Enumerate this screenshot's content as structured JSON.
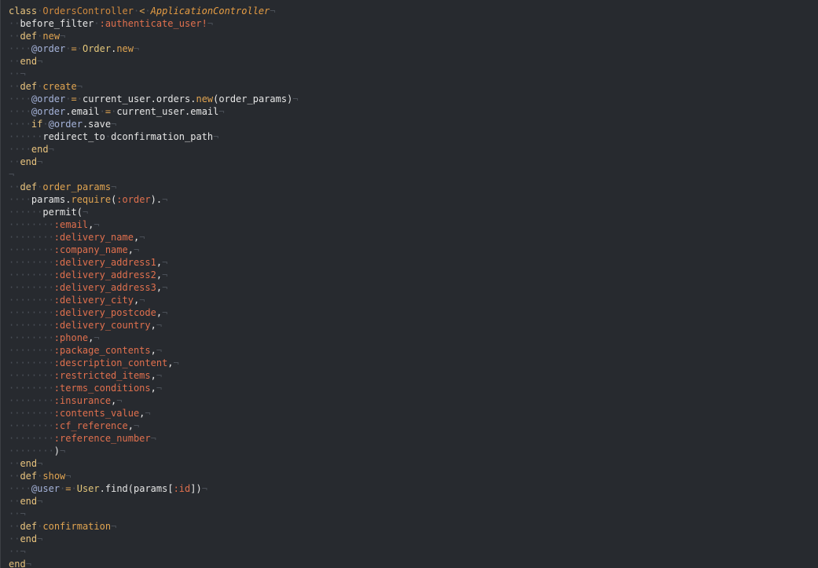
{
  "editor": {
    "lines": [
      [
        {
          "t": "class",
          "c": "kw"
        },
        {
          "t": "·",
          "c": "ws"
        },
        {
          "t": "OrdersController",
          "c": "cls"
        },
        {
          "t": "·",
          "c": "ws"
        },
        {
          "t": "<",
          "c": "op"
        },
        {
          "t": "·",
          "c": "ws"
        },
        {
          "t": "ApplicationController",
          "c": "inh"
        },
        {
          "t": "¬",
          "c": "nl"
        }
      ],
      [
        {
          "t": "··",
          "c": "ws"
        },
        {
          "t": "before_filter",
          "c": "plain"
        },
        {
          "t": "·",
          "c": "ws"
        },
        {
          "t": ":authenticate_user!",
          "c": "sym"
        },
        {
          "t": "¬",
          "c": "nl"
        }
      ],
      [
        {
          "t": "··",
          "c": "ws"
        },
        {
          "t": "def",
          "c": "kw"
        },
        {
          "t": "·",
          "c": "ws"
        },
        {
          "t": "new",
          "c": "meth"
        },
        {
          "t": "¬",
          "c": "nl"
        }
      ],
      [
        {
          "t": "····",
          "c": "ws"
        },
        {
          "t": "@order",
          "c": "ivar"
        },
        {
          "t": "·",
          "c": "ws"
        },
        {
          "t": "=",
          "c": "op"
        },
        {
          "t": "·",
          "c": "ws"
        },
        {
          "t": "Order",
          "c": "const"
        },
        {
          "t": ".",
          "c": "plain"
        },
        {
          "t": "new",
          "c": "meth"
        },
        {
          "t": "¬",
          "c": "nl"
        }
      ],
      [
        {
          "t": "··",
          "c": "ws"
        },
        {
          "t": "end",
          "c": "kw"
        },
        {
          "t": "¬",
          "c": "nl"
        }
      ],
      [
        {
          "t": "··",
          "c": "ws"
        },
        {
          "t": "¬",
          "c": "nl"
        }
      ],
      [
        {
          "t": "··",
          "c": "ws"
        },
        {
          "t": "def",
          "c": "kw"
        },
        {
          "t": "·",
          "c": "ws"
        },
        {
          "t": "create",
          "c": "meth"
        },
        {
          "t": "¬",
          "c": "nl"
        }
      ],
      [
        {
          "t": "····",
          "c": "ws"
        },
        {
          "t": "@order",
          "c": "ivar"
        },
        {
          "t": "·",
          "c": "ws"
        },
        {
          "t": "=",
          "c": "op"
        },
        {
          "t": "·",
          "c": "ws"
        },
        {
          "t": "current_user.orders.",
          "c": "plain"
        },
        {
          "t": "new",
          "c": "meth"
        },
        {
          "t": "(order_params)",
          "c": "plain"
        },
        {
          "t": "¬",
          "c": "nl"
        }
      ],
      [
        {
          "t": "····",
          "c": "ws"
        },
        {
          "t": "@order",
          "c": "ivar"
        },
        {
          "t": ".email",
          "c": "plain"
        },
        {
          "t": "·",
          "c": "ws"
        },
        {
          "t": "=",
          "c": "op"
        },
        {
          "t": "·",
          "c": "ws"
        },
        {
          "t": "current_user.email",
          "c": "plain"
        },
        {
          "t": "¬",
          "c": "nl"
        }
      ],
      [
        {
          "t": "····",
          "c": "ws"
        },
        {
          "t": "if",
          "c": "kw"
        },
        {
          "t": "·",
          "c": "ws"
        },
        {
          "t": "@order",
          "c": "ivar"
        },
        {
          "t": ".save",
          "c": "plain"
        },
        {
          "t": "¬",
          "c": "nl"
        }
      ],
      [
        {
          "t": "······",
          "c": "ws"
        },
        {
          "t": "redirect_to",
          "c": "plain"
        },
        {
          "t": "·",
          "c": "ws"
        },
        {
          "t": "dconfirmation_path",
          "c": "plain"
        },
        {
          "t": "¬",
          "c": "nl"
        }
      ],
      [
        {
          "t": "····",
          "c": "ws"
        },
        {
          "t": "end",
          "c": "kw"
        },
        {
          "t": "¬",
          "c": "nl"
        }
      ],
      [
        {
          "t": "··",
          "c": "ws"
        },
        {
          "t": "end",
          "c": "kw"
        },
        {
          "t": "¬",
          "c": "nl"
        }
      ],
      [
        {
          "t": "¬",
          "c": "nl"
        }
      ],
      [
        {
          "t": "··",
          "c": "ws"
        },
        {
          "t": "def",
          "c": "kw"
        },
        {
          "t": "·",
          "c": "ws"
        },
        {
          "t": "order_params",
          "c": "meth"
        },
        {
          "t": "¬",
          "c": "nl"
        }
      ],
      [
        {
          "t": "····",
          "c": "ws"
        },
        {
          "t": "params.",
          "c": "plain"
        },
        {
          "t": "require",
          "c": "meth"
        },
        {
          "t": "(",
          "c": "plain"
        },
        {
          "t": ":order",
          "c": "sym"
        },
        {
          "t": ").",
          "c": "plain"
        },
        {
          "t": "¬",
          "c": "nl"
        }
      ],
      [
        {
          "t": "······",
          "c": "ws"
        },
        {
          "t": "permit(",
          "c": "plain"
        },
        {
          "t": "¬",
          "c": "nl"
        }
      ],
      [
        {
          "t": "········",
          "c": "ws"
        },
        {
          "t": ":email",
          "c": "sym"
        },
        {
          "t": ",",
          "c": "plain"
        },
        {
          "t": "¬",
          "c": "nl"
        }
      ],
      [
        {
          "t": "········",
          "c": "ws"
        },
        {
          "t": ":delivery_name",
          "c": "sym"
        },
        {
          "t": ",",
          "c": "plain"
        },
        {
          "t": "¬",
          "c": "nl"
        }
      ],
      [
        {
          "t": "········",
          "c": "ws"
        },
        {
          "t": ":company_name",
          "c": "sym"
        },
        {
          "t": ",",
          "c": "plain"
        },
        {
          "t": "¬",
          "c": "nl"
        }
      ],
      [
        {
          "t": "········",
          "c": "ws"
        },
        {
          "t": ":delivery_address1",
          "c": "sym"
        },
        {
          "t": ",",
          "c": "plain"
        },
        {
          "t": "¬",
          "c": "nl"
        }
      ],
      [
        {
          "t": "········",
          "c": "ws"
        },
        {
          "t": ":delivery_address2",
          "c": "sym"
        },
        {
          "t": ",",
          "c": "plain"
        },
        {
          "t": "¬",
          "c": "nl"
        }
      ],
      [
        {
          "t": "········",
          "c": "ws"
        },
        {
          "t": ":delivery_address3",
          "c": "sym"
        },
        {
          "t": ",",
          "c": "plain"
        },
        {
          "t": "¬",
          "c": "nl"
        }
      ],
      [
        {
          "t": "········",
          "c": "ws"
        },
        {
          "t": ":delivery_city",
          "c": "sym"
        },
        {
          "t": ",",
          "c": "plain"
        },
        {
          "t": "¬",
          "c": "nl"
        }
      ],
      [
        {
          "t": "········",
          "c": "ws"
        },
        {
          "t": ":delivery_postcode",
          "c": "sym"
        },
        {
          "t": ",",
          "c": "plain"
        },
        {
          "t": "¬",
          "c": "nl"
        }
      ],
      [
        {
          "t": "········",
          "c": "ws"
        },
        {
          "t": ":delivery_country",
          "c": "sym"
        },
        {
          "t": ",",
          "c": "plain"
        },
        {
          "t": "¬",
          "c": "nl"
        }
      ],
      [
        {
          "t": "········",
          "c": "ws"
        },
        {
          "t": ":phone",
          "c": "sym"
        },
        {
          "t": ",",
          "c": "plain"
        },
        {
          "t": "¬",
          "c": "nl"
        }
      ],
      [
        {
          "t": "········",
          "c": "ws"
        },
        {
          "t": ":package_contents",
          "c": "sym"
        },
        {
          "t": ",",
          "c": "plain"
        },
        {
          "t": "¬",
          "c": "nl"
        }
      ],
      [
        {
          "t": "········",
          "c": "ws"
        },
        {
          "t": ":description_content",
          "c": "sym"
        },
        {
          "t": ",",
          "c": "plain"
        },
        {
          "t": "¬",
          "c": "nl"
        }
      ],
      [
        {
          "t": "········",
          "c": "ws"
        },
        {
          "t": ":restricted_items",
          "c": "sym"
        },
        {
          "t": ",",
          "c": "plain"
        },
        {
          "t": "¬",
          "c": "nl"
        }
      ],
      [
        {
          "t": "········",
          "c": "ws"
        },
        {
          "t": ":terms_conditions",
          "c": "sym"
        },
        {
          "t": ",",
          "c": "plain"
        },
        {
          "t": "¬",
          "c": "nl"
        }
      ],
      [
        {
          "t": "········",
          "c": "ws"
        },
        {
          "t": ":insurance",
          "c": "sym"
        },
        {
          "t": ",",
          "c": "plain"
        },
        {
          "t": "¬",
          "c": "nl"
        }
      ],
      [
        {
          "t": "········",
          "c": "ws"
        },
        {
          "t": ":contents_value",
          "c": "sym"
        },
        {
          "t": ",",
          "c": "plain"
        },
        {
          "t": "¬",
          "c": "nl"
        }
      ],
      [
        {
          "t": "········",
          "c": "ws"
        },
        {
          "t": ":cf_reference",
          "c": "sym"
        },
        {
          "t": ",",
          "c": "plain"
        },
        {
          "t": "¬",
          "c": "nl"
        }
      ],
      [
        {
          "t": "········",
          "c": "ws"
        },
        {
          "t": ":reference_number",
          "c": "sym"
        },
        {
          "t": "¬",
          "c": "nl"
        }
      ],
      [
        {
          "t": "········",
          "c": "ws"
        },
        {
          "t": ")",
          "c": "plain"
        },
        {
          "t": "¬",
          "c": "nl"
        }
      ],
      [
        {
          "t": "··",
          "c": "ws"
        },
        {
          "t": "end",
          "c": "kw"
        },
        {
          "t": "¬",
          "c": "nl"
        }
      ],
      [
        {
          "t": "··",
          "c": "ws"
        },
        {
          "t": "def",
          "c": "kw"
        },
        {
          "t": "·",
          "c": "ws"
        },
        {
          "t": "show",
          "c": "meth"
        },
        {
          "t": "¬",
          "c": "nl"
        }
      ],
      [
        {
          "t": "····",
          "c": "ws"
        },
        {
          "t": "@user",
          "c": "ivar"
        },
        {
          "t": "·",
          "c": "ws"
        },
        {
          "t": "=",
          "c": "op"
        },
        {
          "t": "·",
          "c": "ws"
        },
        {
          "t": "User",
          "c": "const"
        },
        {
          "t": ".find(params[",
          "c": "plain"
        },
        {
          "t": ":id",
          "c": "sym"
        },
        {
          "t": "])",
          "c": "plain"
        },
        {
          "t": "¬",
          "c": "nl"
        }
      ],
      [
        {
          "t": "··",
          "c": "ws"
        },
        {
          "t": "end",
          "c": "kw"
        },
        {
          "t": "¬",
          "c": "nl"
        }
      ],
      [
        {
          "t": "··",
          "c": "ws"
        },
        {
          "t": "¬",
          "c": "nl"
        }
      ],
      [
        {
          "t": "··",
          "c": "ws"
        },
        {
          "t": "def",
          "c": "kw"
        },
        {
          "t": "·",
          "c": "ws"
        },
        {
          "t": "confirmation",
          "c": "meth"
        },
        {
          "t": "¬",
          "c": "nl"
        }
      ],
      [
        {
          "t": "··",
          "c": "ws"
        },
        {
          "t": "end",
          "c": "kw"
        },
        {
          "t": "¬",
          "c": "nl"
        }
      ],
      [
        {
          "t": "··",
          "c": "ws"
        },
        {
          "t": "¬",
          "c": "nl"
        }
      ],
      [
        {
          "t": "end",
          "c": "kw"
        },
        {
          "t": "¬",
          "c": "nl"
        }
      ]
    ]
  }
}
